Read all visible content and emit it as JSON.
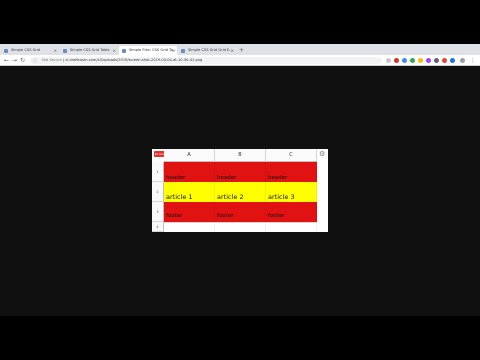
{
  "browser": {
    "tabs": [
      {
        "label": "Simple CSS Grid"
      },
      {
        "label": "Simple CSS Grid Table"
      },
      {
        "label": "Simple Flex: CSS Grid Ta..."
      },
      {
        "label": "Simple CSS Grid Grid E..."
      }
    ],
    "new_tab_label": "+",
    "url_security": "Not Secure",
    "url_text": "cl.draftcosm.com/s3/uploads/2019/screen-shot-2019-04-04-at-10-50-41.png",
    "accent_color": "#1a73e8"
  },
  "sheet": {
    "badge_text": "10 Row",
    "columns": [
      "A",
      "B",
      "C"
    ],
    "rows": [
      {
        "number": "1",
        "cells": [
          "header",
          "header",
          "header"
        ],
        "color": "#e01212"
      },
      {
        "number": "2",
        "cells": [
          "article 1",
          "article 2",
          "article 3"
        ],
        "color": "#ffff00"
      },
      {
        "number": "3",
        "cells": [
          "footer",
          "footer",
          "footer"
        ],
        "color": "#e01212"
      },
      {
        "number": "4",
        "cells": [
          "",
          "",
          ""
        ],
        "color": "#ffffff"
      }
    ]
  }
}
